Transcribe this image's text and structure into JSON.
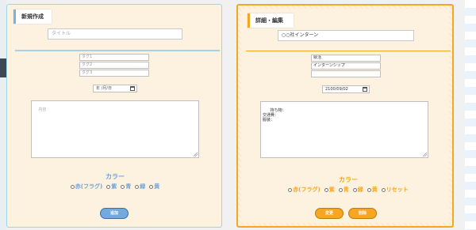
{
  "new_form": {
    "heading": "新規作成",
    "title_placeholder": "タイトル",
    "tags": [
      "タグ1",
      "タグ2",
      "タグ3"
    ],
    "date_placeholder": "年 /月/日",
    "content_placeholder": "内容",
    "color_label": "カラー",
    "color_options": [
      "赤(フラグ)",
      "紫",
      "青",
      "緑",
      "黄"
    ],
    "submit_label": "追加"
  },
  "edit_form": {
    "heading": "詳細・編集",
    "title_value": "○○社インターン",
    "tags": [
      "就活",
      "インターンシップ",
      ""
    ],
    "date_value": "2100/09/02",
    "content_value": "持ち物：\n交通費：\n服装：",
    "color_label": "カラー",
    "color_options": [
      "赤(フラグ)",
      "紫",
      "青",
      "緑",
      "黄",
      "リセット"
    ],
    "update_label": "変更",
    "delete_label": "削除"
  },
  "colors": {
    "new_accent": "#6fa3d6",
    "edit_accent": "#f5a623",
    "panel_bg": "#fdf1e0"
  }
}
